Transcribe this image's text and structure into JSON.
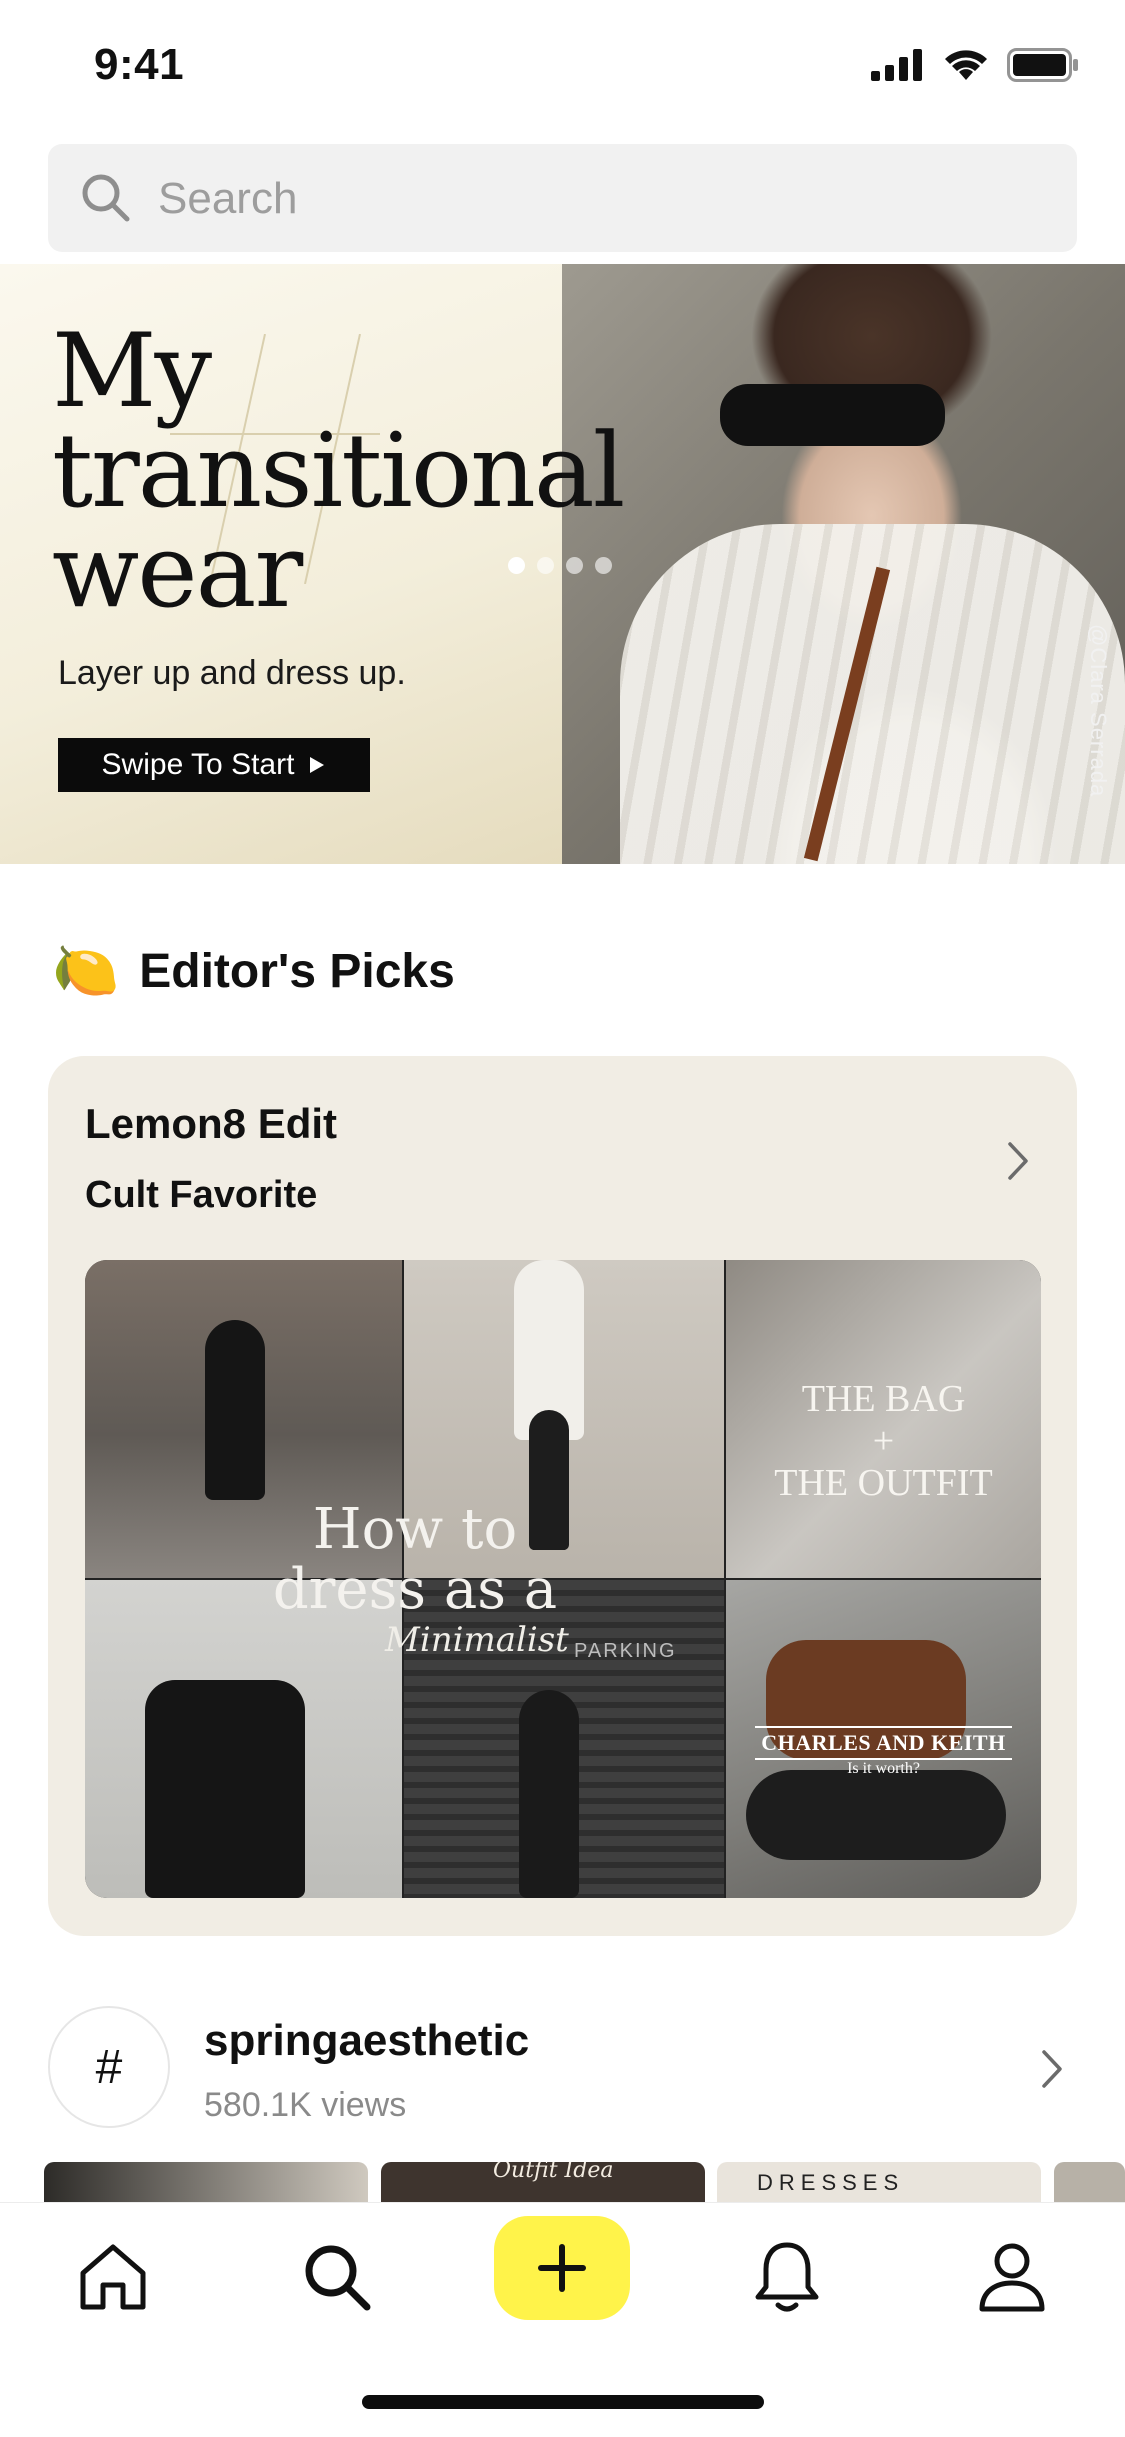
{
  "status_bar": {
    "time": "9:41"
  },
  "search": {
    "placeholder": "Search"
  },
  "hero": {
    "title_line1": "My",
    "title_line2": "transitional",
    "title_line3": "wear",
    "subtitle": "Layer up and dress up.",
    "cta_label": "Swipe To Start",
    "photo_credit": "@Clara Serrada",
    "carousel": {
      "total": 4,
      "active_index": 0
    }
  },
  "editors_picks": {
    "emoji": "🍋",
    "title": "Editor's Picks",
    "card": {
      "title": "Lemon8 Edit",
      "subtitle": "Cult Favorite",
      "collage": {
        "overlay_line1": "How to",
        "overlay_line2": "dress as a",
        "overlay_script": "Minimalist",
        "bag_line1": "THE BAG",
        "bag_line2": "+",
        "bag_line3": "THE OUTFIT",
        "brand_line1": "CHARLES AND KEITH",
        "brand_line2": "Is it worth?",
        "wall_sign": "PARKING"
      }
    }
  },
  "hashtag": {
    "symbol": "#",
    "name": "springaesthetic",
    "views": "580.1K views",
    "thumb_texts": {
      "t2": "Outfit Idea",
      "t3": "DRESSES"
    }
  },
  "tab_bar": {
    "items": [
      "home-icon",
      "search-icon",
      "plus-icon",
      "bell-icon",
      "profile-icon"
    ],
    "active": "search",
    "accent_color": "#fff34a"
  }
}
